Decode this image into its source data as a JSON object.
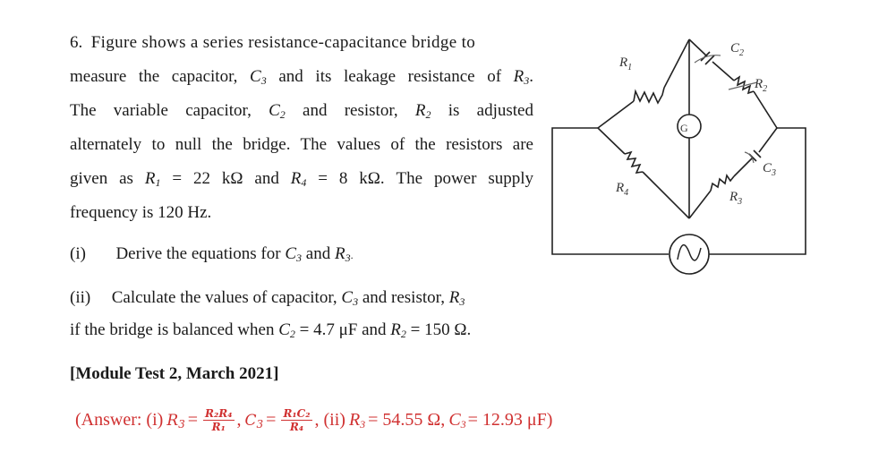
{
  "question": {
    "number": "6.",
    "lines": [
      [
        "Figure shows a series resistance-capacitance bridge to"
      ],
      [
        "measure the capacitor, ",
        "C",
        "3",
        " and its leakage resistance of ",
        "R",
        "3",
        "."
      ],
      [
        "The variable capacitor, ",
        "C",
        "2",
        " and resistor, ",
        "R",
        "2",
        " is adjusted"
      ],
      [
        "alternately to null the bridge. The values of the resistors are"
      ],
      [
        "given as ",
        "R",
        "1",
        " = 22 kΩ and ",
        "R",
        "4",
        " = 8 kΩ. The power supply"
      ],
      [
        "frequency is 120 Hz."
      ]
    ],
    "line1": "Figure shows a series resistance-capacitance bridge to",
    "line2_a": "measure the capacitor,",
    "line2_b": "and its leakage resistance of",
    "line3_a": "The variable capacitor,",
    "line3_b": "and resistor,",
    "line3_c": "is adjusted",
    "line4": "alternately to null the bridge. The values of the resistors are",
    "line5_a": "given as",
    "line5_b": "= 22 kΩ and",
    "line5_c": "= 8 kΩ. The power supply",
    "line6": "frequency is 120 Hz.",
    "part_i_label": "(i)",
    "part_i_text_a": "Derive the equations for",
    "part_i_text_b": "and",
    "part_ii_label": "(ii)",
    "part_ii_text_a": "Calculate the values of capacitor,",
    "part_ii_text_b": "and resistor,",
    "part_ii_line2_a": "if the bridge is balanced when",
    "part_ii_line2_b": "= 4.7 μF and",
    "part_ii_line2_c": "= 150 Ω.",
    "source": "[Module Test 2, March 2021]"
  },
  "vars": {
    "R": "R",
    "C": "C",
    "s1": "1",
    "s2": "2",
    "s3": "3",
    "s4": "4"
  },
  "answer": {
    "prefix": "(Answer: (i)",
    "eq1_lhs_sub": "3",
    "eq1_num": "R₂R₄",
    "eq1_den": "R₁",
    "eq2_num": "R₁C₂",
    "eq2_den": "R₄",
    "part_ii": "(ii)",
    "r3_value": "= 54.55 Ω,",
    "c3_value": "= 12.93 μF)",
    "color": "#d03030"
  },
  "circuit": {
    "labels": {
      "R1": "R",
      "R1_sub": "1",
      "R2": "R",
      "R2_sub": "2",
      "R3": "R",
      "R3_sub": "3",
      "R4": "R",
      "R4_sub": "4",
      "C2": "C",
      "C2_sub": "2",
      "C3": "C",
      "C3_sub": "3",
      "galvanometer": "G"
    },
    "source_icon": "ac-source-icon"
  }
}
